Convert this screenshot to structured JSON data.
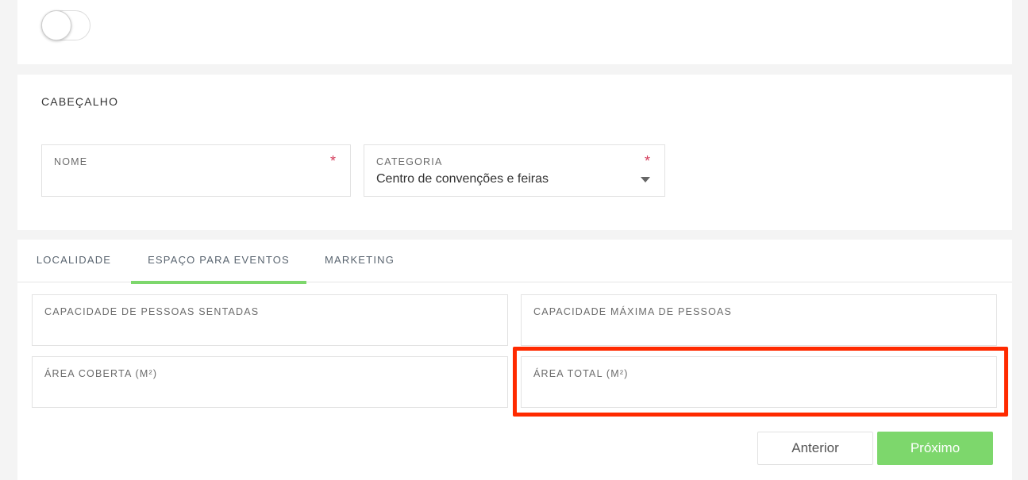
{
  "toggle": {
    "state": "off"
  },
  "header": {
    "title": "CABEÇALHO",
    "fields": {
      "name": {
        "label": "NOME",
        "required_mark": "*",
        "value": ""
      },
      "category": {
        "label": "CATEGORIA",
        "required_mark": "*",
        "value": "Centro de convenções e feiras"
      }
    }
  },
  "tabs": [
    {
      "label": "LOCALIDADE",
      "active": false
    },
    {
      "label": "ESPAÇO PARA EVENTOS",
      "active": true
    },
    {
      "label": "MARKETING",
      "active": false
    }
  ],
  "event_space": {
    "seated_capacity": {
      "label": "CAPACIDADE DE PESSOAS SENTADAS",
      "value": ""
    },
    "max_capacity": {
      "label": "CAPACIDADE MÁXIMA DE PESSOAS",
      "value": ""
    },
    "covered_area": {
      "label": "ÁREA COBERTA (M²)",
      "value": ""
    },
    "total_area": {
      "label": "ÁREA TOTAL (M²)",
      "value": ""
    }
  },
  "buttons": {
    "previous": "Anterior",
    "next": "Próximo"
  },
  "colors": {
    "accent": "#7dd76c",
    "required": "#d43b5a",
    "highlight": "#ff2a00"
  }
}
